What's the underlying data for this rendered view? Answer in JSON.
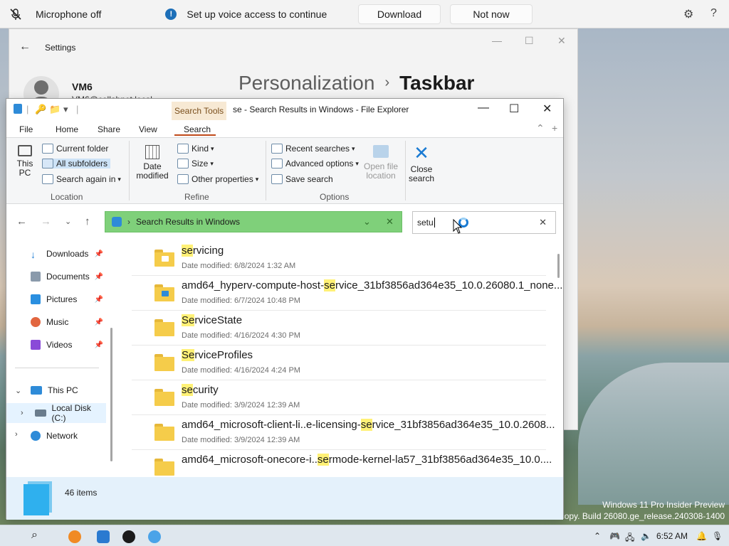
{
  "voice_bar": {
    "mic_status": "Microphone off",
    "message": "Set up voice access to continue",
    "download_label": "Download",
    "not_now_label": "Not now",
    "settings_icon": "gear-icon",
    "help_label": "?"
  },
  "settings": {
    "app_title": "Settings",
    "user_name": "VM6",
    "user_email": "VM6@collabnet.local",
    "breadcrumb_parent": "Personalization",
    "breadcrumb_separator": "›",
    "breadcrumb_current": "Taskbar"
  },
  "explorer": {
    "contextual_tab": "Search Tools",
    "title": "se - Search Results in Windows - File Explorer",
    "tabs": [
      "File",
      "Home",
      "Share",
      "View",
      "Search"
    ],
    "ribbon": {
      "this_pc": "This PC",
      "current_folder": "Current folder",
      "all_subfolders": "All subfolders",
      "search_again_in": "Search again in",
      "group_location": "Location",
      "date_modified": "Date modified",
      "kind": "Kind",
      "size": "Size",
      "other_properties": "Other properties",
      "group_refine": "Refine",
      "recent_searches": "Recent searches",
      "advanced_options": "Advanced options",
      "save_search": "Save search",
      "open_file_location": "Open file location",
      "group_options": "Options",
      "close_search": "Close search"
    },
    "address": "Search Results in Windows",
    "search_value": "setu",
    "nav_pane": {
      "downloads": "Downloads",
      "documents": "Documents",
      "pictures": "Pictures",
      "music": "Music",
      "videos": "Videos",
      "this_pc": "This PC",
      "local_disk": "Local Disk (C:)",
      "network": "Network"
    },
    "results": [
      {
        "pre": "",
        "hl": "se",
        "post": "rvicing",
        "date": "Date modified: 6/8/2024 1:32 AM"
      },
      {
        "pre": "amd64_hyperv-compute-host-",
        "hl": "se",
        "post": "rvice_31bf3856ad364e35_10.0.26080.1_none...",
        "date": "Date modified: 6/7/2024 10:48 PM"
      },
      {
        "pre": "",
        "hl": "Se",
        "post": "rviceState",
        "date": "Date modified: 4/16/2024 4:30 PM"
      },
      {
        "pre": "",
        "hl": "Se",
        "post": "rviceProfiles",
        "date": "Date modified: 4/16/2024 4:24 PM"
      },
      {
        "pre": "",
        "hl": "se",
        "post": "curity",
        "date": "Date modified: 3/9/2024 12:39 AM"
      },
      {
        "pre": "amd64_microsoft-client-li..e-licensing-",
        "hl": "se",
        "post": "rvice_31bf3856ad364e35_10.0.2608...",
        "date": "Date modified: 3/9/2024 12:39 AM"
      },
      {
        "pre": "amd64_microsoft-onecore-i..",
        "hl": "se",
        "post": "rmode-kernel-la57_31bf3856ad364e35_10.0....",
        "date": ""
      }
    ],
    "item_count": "46 items"
  },
  "watermark": {
    "line1": "Windows 11 Pro Insider Preview",
    "line2": "n copy. Build 26080.ge_release.240308-1400"
  },
  "taskbar": {
    "time": "6:52 AM"
  }
}
